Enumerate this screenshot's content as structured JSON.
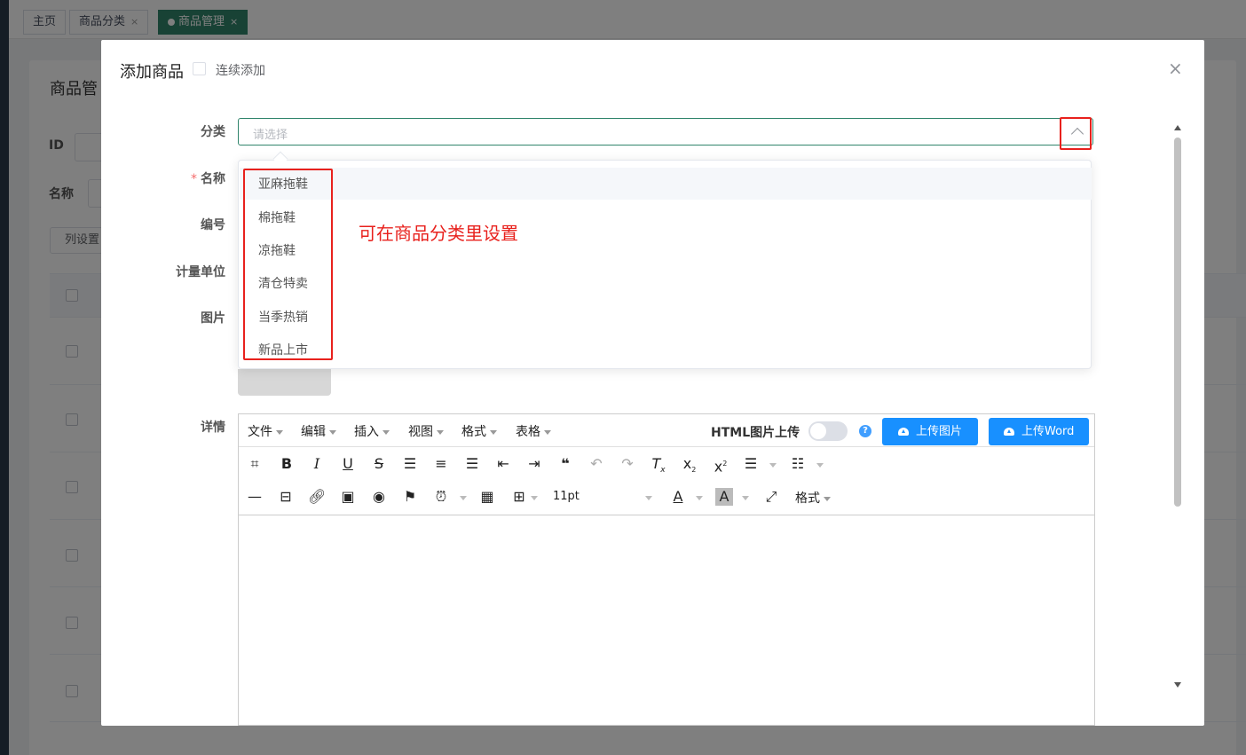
{
  "tabs": [
    {
      "label": "主页",
      "closable": false
    },
    {
      "label": "商品分类",
      "closable": true
    },
    {
      "label": "商品管理",
      "closable": true,
      "active": true
    }
  ],
  "tab_close_glyph": "×",
  "background": {
    "title": "商品管",
    "filters": [
      {
        "label": "ID"
      },
      {
        "label": "名称"
      }
    ],
    "column_settings_button": "列设置"
  },
  "modal": {
    "title": "添加商品",
    "continuous_add_label": "连续添加",
    "close_glyph": "×",
    "form": {
      "category_label": "分类",
      "category_placeholder": "请选择",
      "name_label": "名称",
      "name_required_mark": "*",
      "code_label": "编号",
      "unit_label": "计量单位",
      "image_label": "图片",
      "details_label": "详情"
    },
    "category_options": [
      "亚麻拖鞋",
      "棉拖鞋",
      "凉拖鞋",
      "清仓特卖",
      "当季热销",
      "新品上市"
    ],
    "annotation": "可在商品分类里设置",
    "editor": {
      "menus": [
        "文件",
        "编辑",
        "插入",
        "视图",
        "格式",
        "表格"
      ],
      "html_image_upload_label": "HTML图片上传",
      "help_glyph": "?",
      "upload_image_button": "上传图片",
      "upload_word_button": "上传Word",
      "font_size": "11pt",
      "format_menu": "格式"
    }
  },
  "colors": {
    "accent": "#30856b",
    "primary_button": "#1890ff",
    "annotation_red": "#e8211d"
  }
}
